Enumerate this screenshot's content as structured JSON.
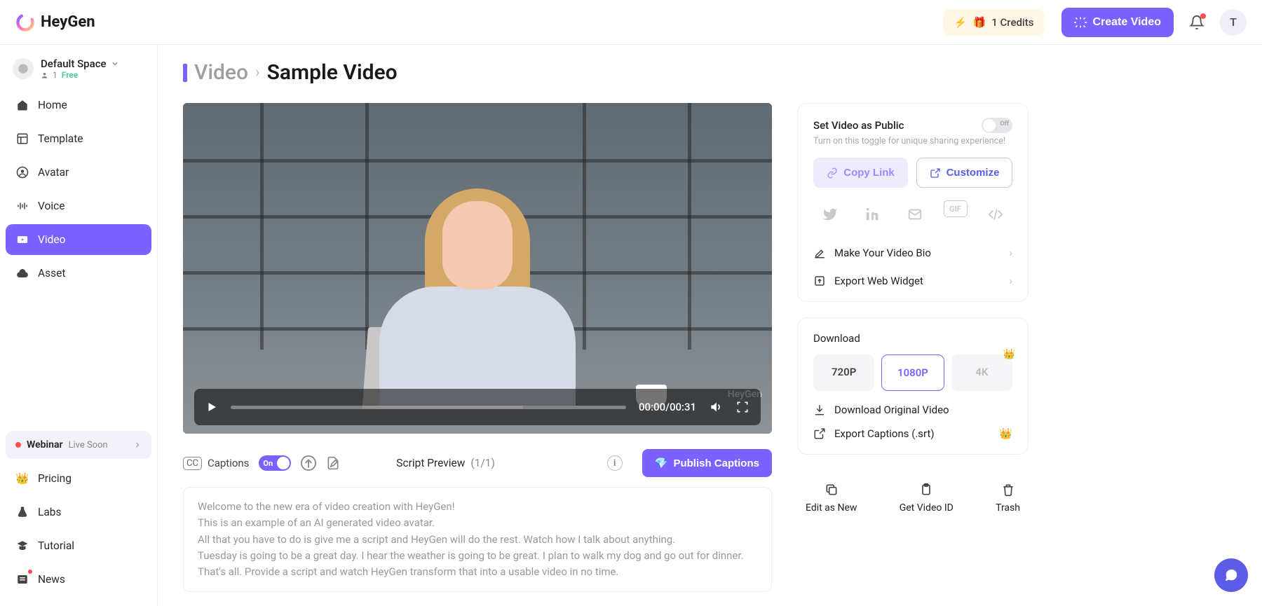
{
  "brand": "HeyGen",
  "header": {
    "credits_label": "1 Credits",
    "create_video": "Create Video",
    "user_initial": "T"
  },
  "space": {
    "name": "Default Space",
    "members": "1",
    "plan": "Free"
  },
  "sidebar": {
    "items": [
      {
        "label": "Home"
      },
      {
        "label": "Template"
      },
      {
        "label": "Avatar"
      },
      {
        "label": "Voice"
      },
      {
        "label": "Video"
      },
      {
        "label": "Asset"
      }
    ],
    "webinar": {
      "label": "Webinar",
      "status": "Live Soon"
    },
    "bottom": [
      {
        "label": "Pricing"
      },
      {
        "label": "Labs"
      },
      {
        "label": "Tutorial"
      },
      {
        "label": "News"
      }
    ]
  },
  "breadcrumb": {
    "section": "Video",
    "title": "Sample Video"
  },
  "player": {
    "time": "00:00/00:31",
    "watermark": "HeyGen"
  },
  "captions": {
    "label": "Captions",
    "toggle": "On",
    "script_preview": "Script Preview",
    "script_count": "(1/1)",
    "publish": "Publish Captions"
  },
  "script_text": "Welcome to the new era of video creation with HeyGen!\nThis is an example of an AI generated video avatar.\nAll that you have to do is give me a script and HeyGen will do the rest. Watch how I talk about anything.\nTuesday is going to be a great day. I hear the weather is going to be great. I plan to walk my dog and go out for dinner.\nThat's all. Provide a script and watch HeyGen transform that into a usable video in no time.",
  "share": {
    "title": "Set Video as Public",
    "sub": "Turn on this toggle for unique sharing experience!",
    "toggle": "Off",
    "copy_link": "Copy Link",
    "customize": "Customize",
    "make_bio": "Make Your Video Bio",
    "export_widget": "Export Web Widget",
    "gif_label": "GIF"
  },
  "download": {
    "title": "Download",
    "res": {
      "r720": "720P",
      "r1080": "1080P",
      "r4k": "4K"
    },
    "original": "Download Original Video",
    "captions": "Export Captions (.srt)"
  },
  "actions": {
    "edit": "Edit as New",
    "get_id": "Get Video ID",
    "trash": "Trash"
  }
}
